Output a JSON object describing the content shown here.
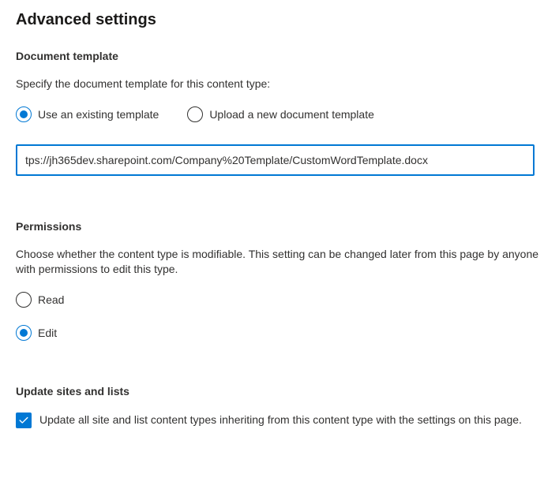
{
  "title": "Advanced settings",
  "documentTemplate": {
    "heading": "Document template",
    "description": "Specify the document template for this content type:",
    "options": {
      "existing": "Use an existing template",
      "upload": "Upload a new document template"
    },
    "urlValue": "tps://jh365dev.sharepoint.com/Company%20Template/CustomWordTemplate.docx"
  },
  "permissions": {
    "heading": "Permissions",
    "description": "Choose whether the content type is modifiable. This setting can be changed later from this page by anyone with permissions to edit this type.",
    "options": {
      "read": "Read",
      "edit": "Edit"
    }
  },
  "updateSites": {
    "heading": "Update sites and lists",
    "checkboxLabel": "Update all site and list content types inheriting from this content type with the settings on this page."
  }
}
